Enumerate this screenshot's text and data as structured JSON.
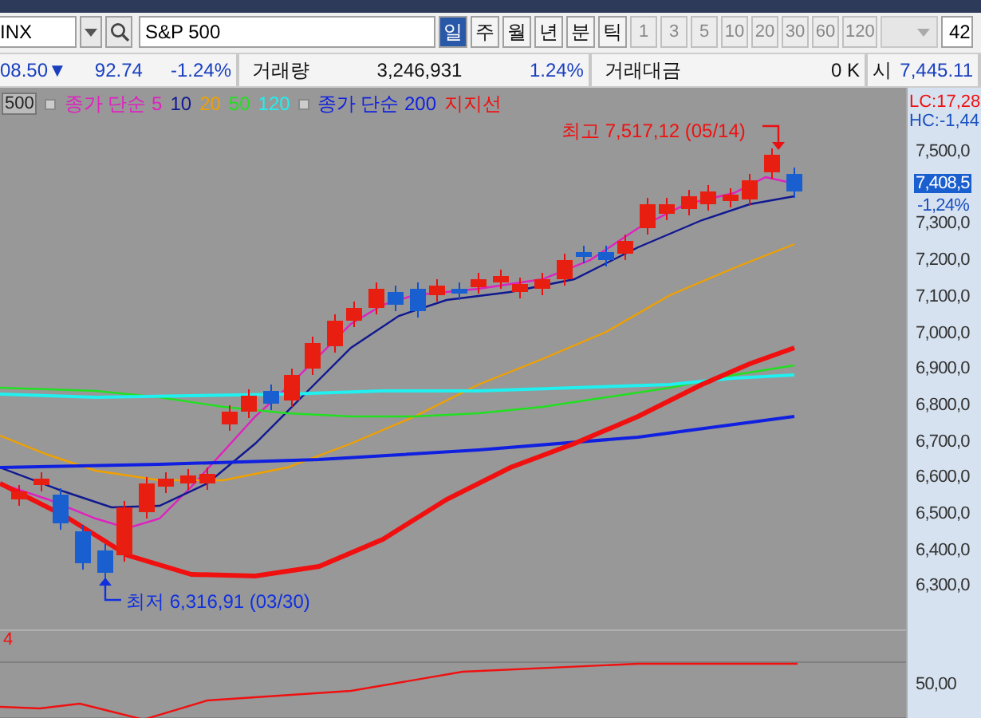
{
  "toolbar": {
    "code": "INX",
    "name": "S&P 500",
    "periods": [
      {
        "label": "일",
        "selected": true
      },
      {
        "label": "주",
        "selected": false
      },
      {
        "label": "월",
        "selected": false
      },
      {
        "label": "년",
        "selected": false
      },
      {
        "label": "분",
        "selected": false
      },
      {
        "label": "틱",
        "selected": false
      }
    ],
    "intervals": [
      "1",
      "3",
      "5",
      "10",
      "20",
      "30",
      "60",
      "120"
    ],
    "count": "42"
  },
  "quote": {
    "price": "08.50",
    "change_sign": "▼",
    "change": "92.74",
    "change_pct": "-1.24%",
    "volume_label": "거래량",
    "volume": "3,246,931",
    "volume_pct": "1.24%",
    "amount_label": "거래대금",
    "amount": "0 K",
    "open_label": "시",
    "open": "7,445.11"
  },
  "legend": {
    "period_box": "500",
    "groups": [
      {
        "items": [
          {
            "label": "종가 단순 5",
            "color": "#e020c0"
          },
          {
            "label": "10",
            "color": "#101890"
          },
          {
            "label": "20",
            "color": "#f0a000"
          },
          {
            "label": "50",
            "color": "#20e020"
          },
          {
            "label": "120",
            "color": "#20f0f0"
          }
        ]
      },
      {
        "items": [
          {
            "label": "종가 단순 200",
            "color": "#1020e0"
          }
        ]
      }
    ],
    "support": {
      "label": "지지선",
      "color": "#f01010"
    }
  },
  "lc": "LC:17,28",
  "hc": "HC:-1,44",
  "annotations": {
    "high": "최고 7,517,12 (05/14)",
    "low": "최저 6,316,91 (03/30)"
  },
  "axis": {
    "ticks": [
      "7,500,0",
      "7,300,0",
      "7,200,0",
      "7,100,0",
      "7,000,0",
      "6,900,0",
      "6,800,0",
      "6,700,0",
      "6,600,0",
      "6,500,0",
      "6,400,0",
      "6,300,0"
    ],
    "price_tag": "7,408,5",
    "price_change": "-1,24%",
    "lower_tick": "50,00"
  },
  "lower_pane": {
    "label": "4"
  }
}
